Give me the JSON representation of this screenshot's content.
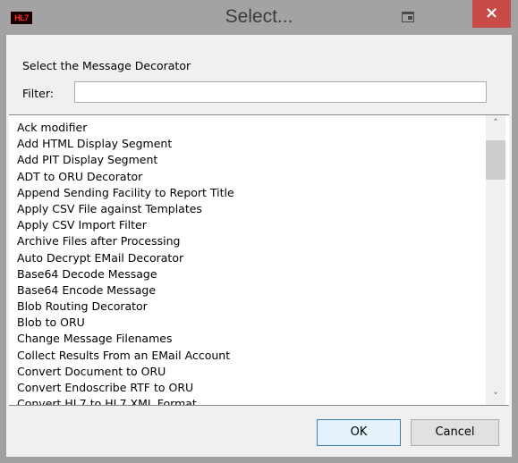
{
  "window": {
    "title": "Select...",
    "app_icon_text": "HL7",
    "close_glyph": "×"
  },
  "dialog": {
    "prompt": "Select the Message Decorator",
    "filter_label": "Filter:",
    "filter_value": ""
  },
  "list": {
    "items": [
      "Ack modifier",
      "Add HTML Display Segment",
      "Add PIT Display Segment",
      "ADT to ORU Decorator",
      "Append Sending Facility to Report Title",
      "Apply CSV File against Templates",
      "Apply CSV Import Filter",
      "Archive Files after Processing",
      "Auto Decrypt EMail Decorator",
      "Base64 Decode Message",
      "Base64 Encode Message",
      "Blob Routing Decorator",
      "Blob to ORU",
      "Change Message Filenames",
      "Collect Results From an EMail Account",
      "Convert Document to ORU",
      "Convert Endoscribe RTF to ORU",
      "Convert HL7 to HL7 XML Format"
    ],
    "scroll_up_glyph": "˄",
    "scroll_down_glyph": "˅"
  },
  "buttons": {
    "ok": "OK",
    "cancel": "Cancel"
  },
  "colors": {
    "close_button": "#c84b47",
    "titlebar": "#a3a3a3",
    "client": "#f0f0f0",
    "ok_border": "#3c7fb1"
  }
}
